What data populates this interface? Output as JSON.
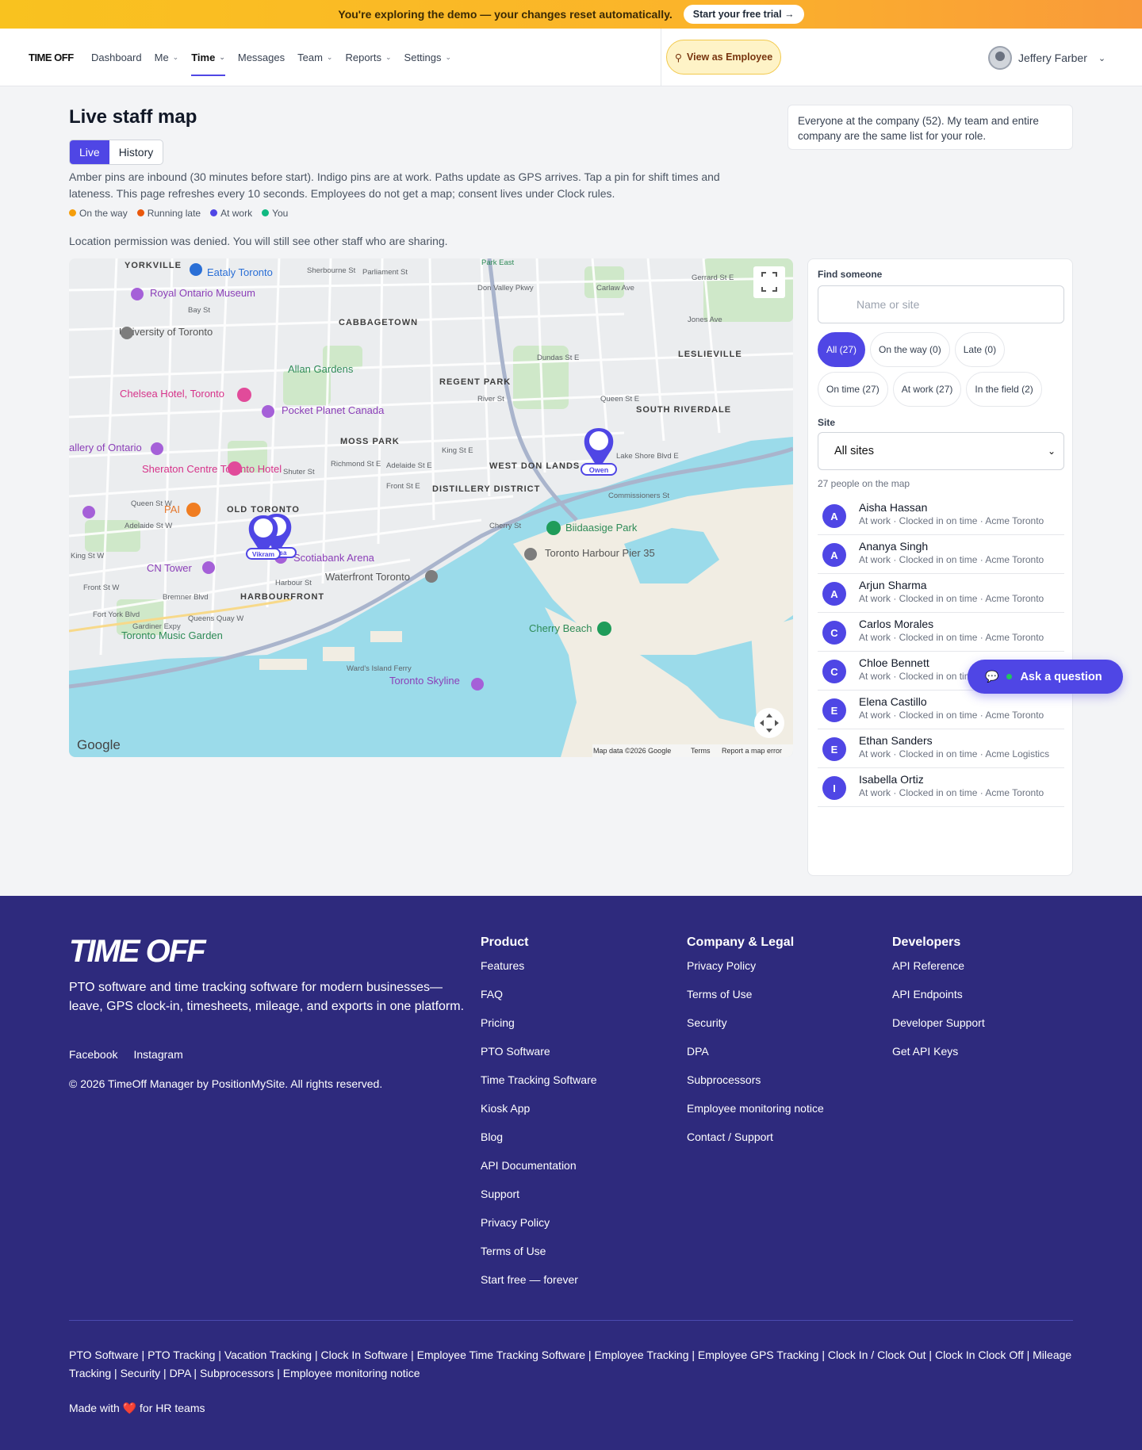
{
  "banner": {
    "text": "You're exploring the demo — your changes reset automatically.",
    "cta": "Start your free trial →"
  },
  "nav": {
    "logo": "TIME OFF",
    "links": [
      {
        "label": "Dashboard",
        "chev": false
      },
      {
        "label": "Me",
        "chev": true
      },
      {
        "label": "Time",
        "chev": true,
        "active": true
      },
      {
        "label": "Messages",
        "chev": false
      },
      {
        "label": "Team",
        "chev": true
      },
      {
        "label": "Reports",
        "chev": true
      },
      {
        "label": "Settings",
        "chev": true
      }
    ],
    "view_as": "View as Employee",
    "user": "Jeffery Farber"
  },
  "page": {
    "title": "Live staff map",
    "scope": "Everyone at the company (52). My team and entire company are the same list for your role.",
    "tabs": [
      "Live",
      "History"
    ],
    "description": "Amber pins are inbound (30 minutes before start). Indigo pins are at work. Paths update as GPS arrives. Tap a pin for shift times and lateness. This page refreshes every 10 seconds. Employees do not get a map; consent lives under Clock rules.",
    "legend": [
      {
        "label": "On the way",
        "color": "#f59e0b"
      },
      {
        "label": "Running late",
        "color": "#ea580c"
      },
      {
        "label": "At work",
        "color": "#4f46e5"
      },
      {
        "label": "You",
        "color": "#10b981"
      }
    ],
    "permission": "Location permission was denied. You will still see other staff who are sharing."
  },
  "map": {
    "labels": [
      "YORKVILLE",
      "Eataly Toronto",
      "Royal Ontario Museum",
      "CABBAGETOWN",
      "University of Toronto",
      "Allan Gardens",
      "REGENT PARK",
      "LESLIEVILLE",
      "Chelsea Hotel, Toronto",
      "Pocket Planet Canada",
      "SOUTH RIVERDALE",
      "WEST DON LANDS",
      "MOSS PARK",
      "allery of Ontario",
      "Sheraton Centre Toronto Hotel",
      "DISTILLERY DISTRICT",
      "PAI",
      "OLD TORONTO",
      "Biidaasige Park",
      "Waterfront Toronto",
      "Toronto Harbour Pier 35",
      "CN Tower",
      "Scotiabank Arena",
      "HARBOURFRONT",
      "Cherry Beach",
      "Toronto Music Garden",
      "Toronto Skyline",
      "Google",
      "Map data ©2026 Google",
      "Terms",
      "Report a map error",
      "Park East",
      "Gerrard St E",
      "Queen St E",
      "Lake Shore Blvd E",
      "Commissioners St",
      "Front St E",
      "King St E",
      "Adelaide St E",
      "Richmond St E",
      "Queen St W",
      "Adelaide St W",
      "King St W",
      "Front St W",
      "Bremner Blvd",
      "Gardiner Expy",
      "Queens Quay W",
      "Harbour St",
      "Shuter St",
      "Dundas St E",
      "Parliament St",
      "Sherbourne St",
      "Bay St",
      "Don Valley Pkwy",
      "River St",
      "Cherry St",
      "Carlaw Ave",
      "Jones Ave",
      "Fort York Blvd",
      "Ward's Island Ferry"
    ],
    "pins": [
      {
        "name": "Owen"
      },
      {
        "name": "Vikram"
      },
      {
        "name": "sa"
      }
    ]
  },
  "panel": {
    "find_label": "Find someone",
    "search_placeholder": "Name or site",
    "filters_row1": [
      "All (27)",
      "On the way (0)",
      "Late (0)"
    ],
    "filters_row2": [
      "On time (27)",
      "At work (27)",
      "In the field (2)"
    ],
    "site_label": "Site",
    "site_value": "All sites",
    "count": "27 people on the map",
    "people": [
      {
        "initial": "A",
        "name": "Aisha Hassan",
        "status": "At work · Clocked in on time · Acme Toronto"
      },
      {
        "initial": "A",
        "name": "Ananya Singh",
        "status": "At work · Clocked in on time · Acme Toronto"
      },
      {
        "initial": "A",
        "name": "Arjun Sharma",
        "status": "At work · Clocked in on time · Acme Toronto"
      },
      {
        "initial": "C",
        "name": "Carlos Morales",
        "status": "At work · Clocked in on time · Acme Toronto"
      },
      {
        "initial": "C",
        "name": "Chloe Bennett",
        "status": "At work · Clocked in on time · Acme Toronto"
      },
      {
        "initial": "E",
        "name": "Elena Castillo",
        "status": "At work · Clocked in on time · Acme Toronto"
      },
      {
        "initial": "E",
        "name": "Ethan Sanders",
        "status": "At work · Clocked in on time · Acme Logistics"
      },
      {
        "initial": "I",
        "name": "Isabella Ortiz",
        "status": "At work · Clocked in on time · Acme Toronto"
      }
    ]
  },
  "ask": "Ask a question",
  "footer": {
    "logo": "TIME OFF",
    "tagline": "PTO software and time tracking software for modern businesses—leave, GPS clock-in, timesheets, mileage, and exports in one platform.",
    "social": [
      "Facebook",
      "Instagram"
    ],
    "copyright": "© 2026 TimeOff Manager by PositionMySite. All rights reserved.",
    "product": {
      "title": "Product",
      "links": [
        "Features",
        "FAQ",
        "Pricing",
        "PTO Software",
        "Time Tracking Software",
        "Kiosk App",
        "Blog",
        "API Documentation",
        "Support",
        "Privacy Policy",
        "Terms of Use",
        "Start free — forever"
      ]
    },
    "company": {
      "title": "Company & Legal",
      "links": [
        "Privacy Policy",
        "Terms of Use",
        "Security",
        "DPA",
        "Subprocessors",
        "Employee monitoring notice",
        "Contact / Support"
      ]
    },
    "developers": {
      "title": "Developers",
      "links": [
        "API Reference",
        "API Endpoints",
        "Developer Support",
        "Get API Keys"
      ]
    },
    "seo": "PTO Software | PTO Tracking | Vacation Tracking | Clock In Software | Employee Time Tracking Software | Employee Tracking | Employee GPS Tracking | Clock In / Clock Out | Clock In Clock Off | Mileage Tracking | Security | DPA | Subprocessors | Employee monitoring notice",
    "made": "Made with ❤️ for HR teams"
  }
}
